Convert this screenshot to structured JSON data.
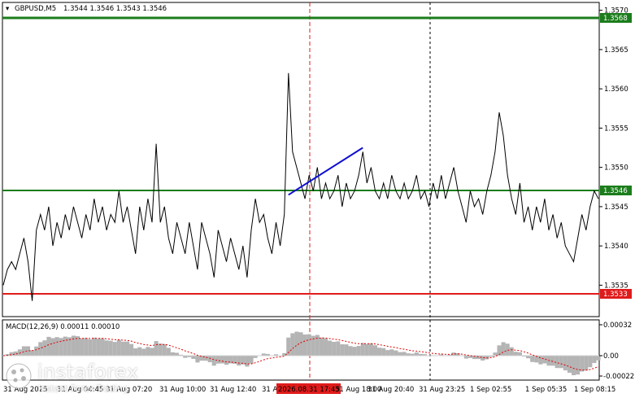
{
  "header": {
    "symbol_label": "GBPUSD,M5",
    "ohlc": "1.3544 1.3546 1.3543 1.3546"
  },
  "macd": {
    "label": "MACD(12,26,9) 0.00011 0.00010",
    "ticks": [
      "0.00032",
      "0.00",
      "-0.00022"
    ]
  },
  "levels": {
    "top_green": "1.3568",
    "middle_green": "1.3546",
    "red": "1.3533"
  },
  "x_axis": {
    "labels": [
      "31 Aug 2025",
      "31 Aug 04:45",
      "31 Aug 07:20",
      "31 Aug 10:00",
      "31 Aug 12:40",
      "31 Aug 15:15",
      "2026.08.31 17:45",
      "31 Aug 18:00",
      "31 Aug 20:40",
      "31 Aug 23:25",
      "1 Sep 02:55",
      "1 Sep 05:35",
      "1 Sep 08:15"
    ],
    "highlight": "2026.08.31 17:45"
  },
  "watermark": {
    "name": "instaforex",
    "tagline": "Instant Forex Trading"
  },
  "colors": {
    "price_line": "#000000",
    "green_level": "#1b7d1b",
    "red_level": "#e01b1b",
    "trend_line": "#1010d0",
    "macd_hist": "#b4b4b4",
    "macd_signal": "#e00000",
    "highlight_bg": "#e01b1b"
  },
  "chart_data": {
    "type": "line",
    "title": "GBPUSD,M5",
    "y_ticks": [
      "1.3570",
      "1.3565",
      "1.3560",
      "1.3555",
      "1.3550",
      "1.3545",
      "1.3540",
      "1.3535"
    ],
    "ylim": [
      1.3531,
      1.3571
    ],
    "levels": [
      {
        "value": 1.3568,
        "color": "green"
      },
      {
        "value": 1.3546,
        "color": "green"
      },
      {
        "value": 1.3533,
        "color": "red"
      }
    ],
    "series": [
      {
        "values": [
          1.3535,
          1.3537,
          1.3538,
          1.3537,
          1.3539,
          1.3541,
          1.3538,
          1.3533,
          1.3542,
          1.3544,
          1.3542,
          1.3545,
          1.354,
          1.3543,
          1.3541,
          1.3544,
          1.3542,
          1.3545,
          1.3543,
          1.3541,
          1.3544,
          1.3542,
          1.3546,
          1.3543,
          1.3545,
          1.3542,
          1.3544,
          1.3543,
          1.3547,
          1.3543,
          1.3545,
          1.3542,
          1.3539,
          1.3545,
          1.3542,
          1.3546,
          1.3543,
          1.3553,
          1.3543,
          1.3545,
          1.3541,
          1.3539,
          1.3543,
          1.3541,
          1.3539,
          1.3543,
          1.354,
          1.3537,
          1.3543,
          1.3541,
          1.3539,
          1.3536,
          1.3542,
          1.354,
          1.3538,
          1.3541,
          1.3539,
          1.3537,
          1.354,
          1.3536,
          1.3542,
          1.3546,
          1.3543,
          1.3544,
          1.3541,
          1.3539,
          1.3543,
          1.354,
          1.3544,
          1.3562,
          1.3552,
          1.355,
          1.3548,
          1.3546,
          1.3549,
          1.3547,
          1.355,
          1.3546,
          1.3548,
          1.3546,
          1.3547,
          1.3549,
          1.3545,
          1.3548,
          1.3546,
          1.3547,
          1.3549,
          1.3552,
          1.3548,
          1.355,
          1.3547,
          1.3546,
          1.3548,
          1.3546,
          1.3549,
          1.3547,
          1.3546,
          1.3548,
          1.3546,
          1.3547,
          1.3549,
          1.3546,
          1.3547,
          1.3545,
          1.3548,
          1.3546,
          1.3549,
          1.3546,
          1.3548,
          1.355,
          1.3547,
          1.3545,
          1.3543,
          1.3547,
          1.3545,
          1.3546,
          1.3544,
          1.3547,
          1.3549,
          1.3552,
          1.3557,
          1.3554,
          1.3549,
          1.3546,
          1.3544,
          1.3548,
          1.3543,
          1.3545,
          1.3542,
          1.3545,
          1.3543,
          1.3546,
          1.3542,
          1.3544,
          1.3541,
          1.3543,
          1.354,
          1.3539,
          1.3538,
          1.3541,
          1.3544,
          1.3542,
          1.3545,
          1.3547,
          1.3546
        ]
      },
      {
        "values": [
          1.35465,
          1.35525
        ]
      }
    ]
  }
}
